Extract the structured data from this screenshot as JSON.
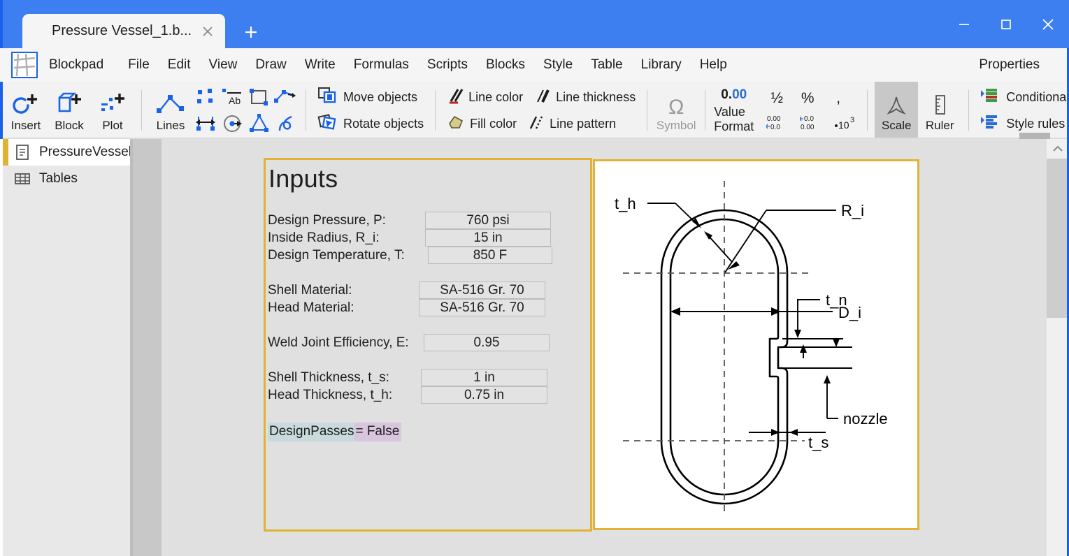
{
  "window": {
    "tab_title": "Pressure Vessel_1.b...",
    "tab_close_icon": "close-icon",
    "new_tab_icon": "plus-icon",
    "minimize_icon": "minimize-icon",
    "maximize_icon": "maximize-icon",
    "close_icon": "close-icon",
    "accent_color": "#3d7ef0"
  },
  "menubar": {
    "logo_icon": "blockpad-logo-icon",
    "brand": "Blockpad",
    "items": [
      {
        "label": "File"
      },
      {
        "label": "Edit"
      },
      {
        "label": "View"
      },
      {
        "label": "Draw"
      },
      {
        "label": "Write"
      },
      {
        "label": "Formulas"
      },
      {
        "label": "Scripts"
      },
      {
        "label": "Blocks"
      },
      {
        "label": "Style"
      },
      {
        "label": "Table"
      },
      {
        "label": "Library"
      },
      {
        "label": "Help"
      }
    ],
    "properties": "Properties"
  },
  "ribbon": {
    "insert": {
      "label": "Insert",
      "icon": "insert-plus-icon"
    },
    "block": {
      "label": "Block",
      "icon": "block-plus-icon"
    },
    "plot": {
      "label": "Plot",
      "icon": "plot-plus-icon"
    },
    "lines": {
      "label": "Lines",
      "icon": "polyline-icon"
    },
    "draw_icons": [
      "points-icon",
      "text-label-icon",
      "rectangle-icon",
      "dimension-icon",
      "distance-icon",
      "circle-icon",
      "polygon-icon",
      "spline-icon"
    ],
    "move_objects": {
      "label": "Move objects",
      "icon": "move-objects-icon"
    },
    "rotate_objects": {
      "label": "Rotate objects",
      "icon": "rotate-objects-icon"
    },
    "line_color": {
      "label": "Line color",
      "icon": "line-color-icon"
    },
    "line_thickness": {
      "label": "Line thickness",
      "icon": "line-thickness-icon"
    },
    "fill_color": {
      "label": "Fill color",
      "icon": "fill-color-icon"
    },
    "line_pattern": {
      "label": "Line pattern",
      "icon": "line-pattern-icon"
    },
    "symbol": {
      "label": "Symbol",
      "glyph": "Ω",
      "icon": "omega-symbol-icon",
      "disabled": true
    },
    "value_format": {
      "label": "Value Format",
      "sample_black": "0.",
      "sample_blue": "00"
    },
    "number_icons_row1": [
      "½",
      "%",
      ","
    ],
    "number_icons_row2": [
      "0.00→0.0",
      "←0.0 0.00",
      "·10³"
    ],
    "scale": {
      "label": "Scale",
      "icon": "scale-icon",
      "active": true
    },
    "ruler": {
      "label": "Ruler",
      "icon": "ruler-icon"
    },
    "conditional_formatting": {
      "label": "Conditional form",
      "icon": "conditional-formatting-icon"
    },
    "style_rules": {
      "label": "Style rules",
      "icon": "style-rules-icon"
    }
  },
  "sidebar": {
    "items": [
      {
        "label": "PressureVessel",
        "icon": "document-icon",
        "selected": true
      },
      {
        "label": "Tables",
        "icon": "table-grid-icon",
        "selected": false
      }
    ]
  },
  "inputs_panel": {
    "title": "Inputs",
    "rows": [
      {
        "label": "Design Pressure, P:",
        "value": "760 psi"
      },
      {
        "label": "Inside Radius, R_i:",
        "value": "15 in"
      },
      {
        "label": "Design Temperature, T:",
        "value": "850 F"
      },
      {
        "label": "Shell Material:",
        "value": "SA-516 Gr. 70"
      },
      {
        "label": "Head Material:",
        "value": "SA-516 Gr. 70"
      },
      {
        "label": "Weld Joint Efficiency, E:",
        "value": "0.95"
      },
      {
        "label": "Shell Thickness, t_s:",
        "value": "1 in"
      },
      {
        "label": "Head Thickness, t_h:",
        "value": "0.75 in"
      }
    ],
    "formula": {
      "variable": "DesignPasses",
      "expression": " = False"
    },
    "border_color": "#dfb334",
    "highlight_var_color": "#c9dadc",
    "highlight_val_color": "#d9c6de"
  },
  "diagram_panel": {
    "border_color": "#dfb334",
    "background": "#ffffff",
    "labels": [
      {
        "name": "t_h",
        "text": "t_h"
      },
      {
        "name": "R_i",
        "text": "R_i"
      },
      {
        "name": "D_i",
        "text": "D_i"
      },
      {
        "name": "t_n",
        "text": "t_n"
      },
      {
        "name": "nozzle",
        "text": "nozzle"
      },
      {
        "name": "t_s",
        "text": "t_s"
      }
    ]
  },
  "scrollbar": {
    "up_arrow_icon": "chevron-up-icon"
  }
}
